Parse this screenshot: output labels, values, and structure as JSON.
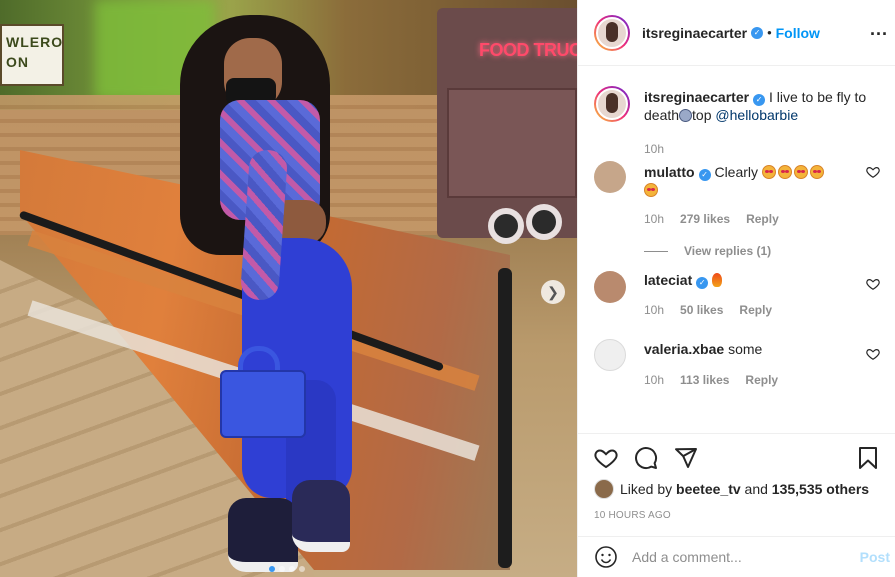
{
  "post": {
    "image": {
      "sign_text_line1": "WLERO",
      "sign_text_line2": "ON",
      "truck_sign": "FOOD TRUCK",
      "carousel_dots": 4,
      "carousel_active": 1
    },
    "header": {
      "username": "itsreginaecarter",
      "separator": "•",
      "follow_label": "Follow",
      "more_label": "..."
    },
    "caption": {
      "username": "itsreginaecarter",
      "text_a": "I live to be fly to death",
      "text_b": "top",
      "mention": "@hellobarbie",
      "time": "10h"
    },
    "comments": [
      {
        "username": "mulatto",
        "text": "Clearly",
        "time": "10h",
        "likes": "279 likes",
        "reply": "Reply",
        "view_replies": "View replies (1)"
      },
      {
        "username": "lateciat",
        "text": "",
        "time": "10h",
        "likes": "50 likes",
        "reply": "Reply"
      },
      {
        "username": "valeria.xbae",
        "text": "some",
        "time": "10h",
        "likes": "113 likes",
        "reply": "Reply"
      }
    ],
    "likes": {
      "prefix": "Liked by",
      "user": "beetee_tv",
      "and": "and",
      "others": "135,535 others"
    },
    "time_ago": "10 HOURS AGO",
    "add_comment": {
      "placeholder": "Add a comment...",
      "post_label": "Post"
    },
    "colors": {
      "accent": "#0095f6",
      "verified": "#3897f0",
      "muted": "#8e8e8e"
    },
    "icons": [
      "heart-icon",
      "comment-icon",
      "share-icon",
      "bookmark-icon",
      "smiley-icon",
      "verified-icon",
      "chevron-right-icon"
    ]
  }
}
